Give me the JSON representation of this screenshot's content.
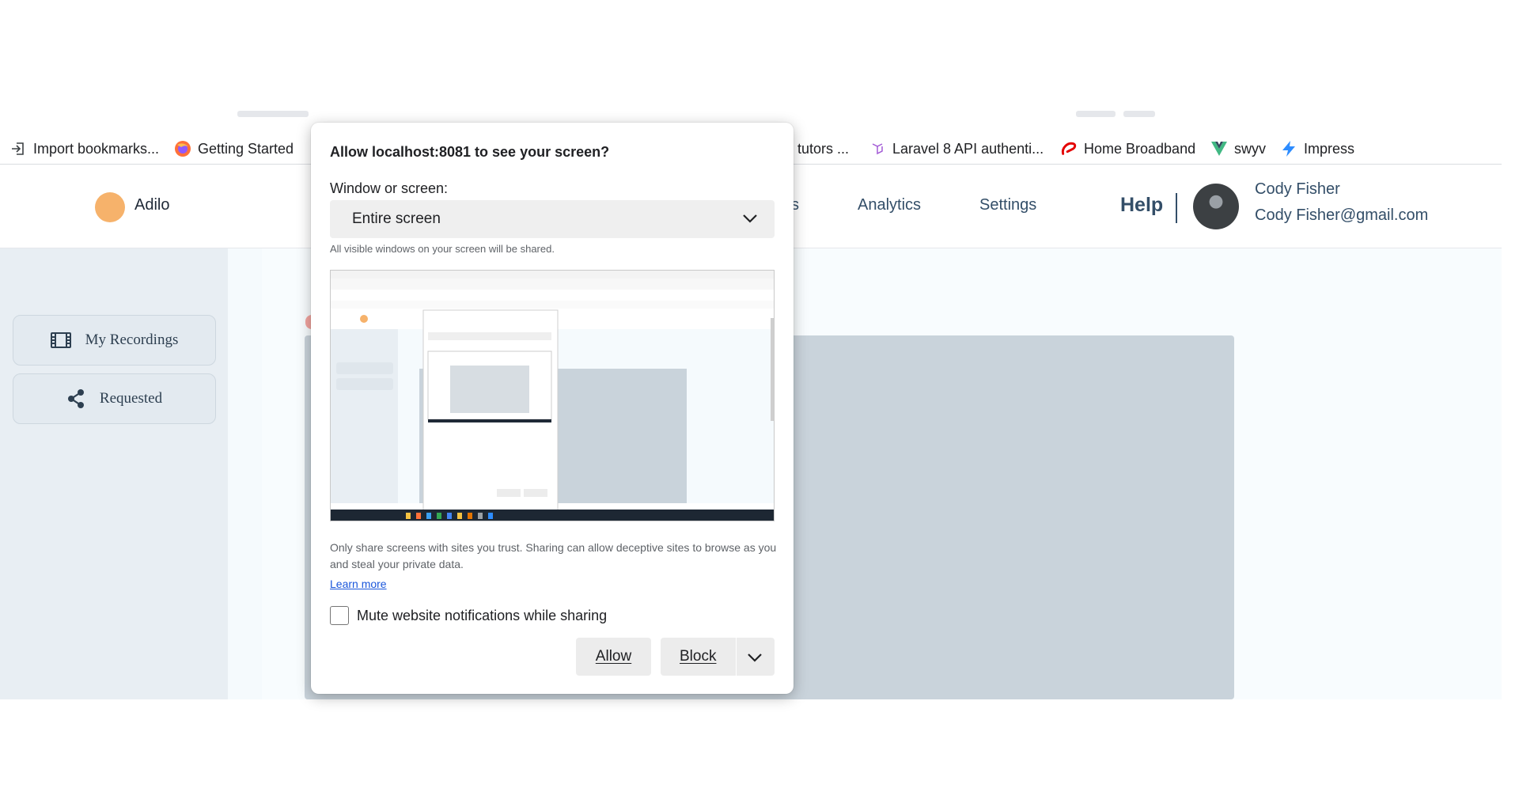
{
  "bookmarks": {
    "import": "Import bookmarks...",
    "getting_started": "Getting Started",
    "tutors": "tutors ...",
    "laravel": "Laravel 8 API authenti...",
    "broadband": "Home Broadband",
    "swyv": "swyv",
    "impress": "Impress"
  },
  "header": {
    "logo": "Adilo",
    "nav": [
      "s",
      "Analytics",
      "Settings"
    ],
    "help": "Help",
    "user_name": "Cody Fisher",
    "user_email": "Cody Fisher@gmail.com"
  },
  "sidebar": {
    "items": [
      {
        "label": "My Recordings",
        "icon": "film-icon"
      },
      {
        "label": "Requested",
        "icon": "share-icon"
      }
    ]
  },
  "dialog": {
    "title": "Allow localhost:8081 to see your screen?",
    "select_label": "Window or screen:",
    "select_value": "Entire screen",
    "hint": "All visible windows on your screen will be shared.",
    "warning": "Only share screens with sites you trust. Sharing can allow deceptive sites to browse as you and steal your private data.",
    "learn_more": "Learn more",
    "checkbox_label": "Mute website notifications while sharing",
    "allow": "Allow",
    "block": "Block"
  },
  "colors": {
    "accent": "#334e68",
    "logo": "#f6b26b",
    "video_area": "#c9d3db"
  }
}
